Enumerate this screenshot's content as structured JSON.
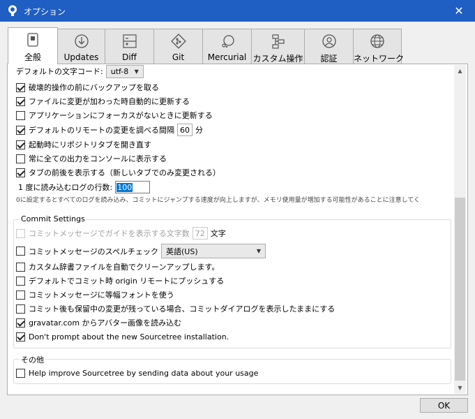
{
  "window": {
    "title": "オプション",
    "close_glyph": "✕"
  },
  "tabs": [
    {
      "label": "全般",
      "icon": "switch-icon",
      "active": true
    },
    {
      "label": "Updates",
      "icon": "download-circle-icon"
    },
    {
      "label": "Diff",
      "icon": "diff-icon"
    },
    {
      "label": "Git",
      "icon": "git-icon"
    },
    {
      "label": "Mercurial",
      "icon": "mercurial-icon"
    },
    {
      "label": "カスタム操作",
      "icon": "custom-actions-icon"
    },
    {
      "label": "認証",
      "icon": "user-icon"
    },
    {
      "label": "ネットワーク",
      "icon": "globe-icon"
    }
  ],
  "general": {
    "encoding_label": "デフォルトの文字コード:",
    "encoding_value": "utf-8",
    "options": [
      {
        "label": "破壊的操作の前にバックアップを取る",
        "checked": true
      },
      {
        "label": "ファイルに変更が加わった時自動的に更新する",
        "checked": true
      },
      {
        "label": "アプリケーションにフォーカスがないときに更新する",
        "checked": false
      },
      {
        "label": "デフォルトのリモートの変更を調べる間隔",
        "checked": true,
        "value": "60",
        "unit": "分"
      },
      {
        "label": "起動時にリポジトリタブを開き直す",
        "checked": true
      },
      {
        "label": "常に全ての出力をコンソールに表示する",
        "checked": false
      },
      {
        "label": "タブの前後を表示する（新しいタブでのみ変更される）",
        "checked": true
      }
    ],
    "log_count_label": "1 度に読み込むログの行数:",
    "log_count_value": "100",
    "log_note": "0に設定するとすべてのログを読み込み、コミットにジャンプする速度が向上しますが、メモリ使用量が増加する可能性があることに注意してく"
  },
  "commit_settings": {
    "title": "Commit Settings",
    "guide_label": "コミットメッセージでガイドを表示する文字数",
    "guide_value": "72",
    "guide_unit": "文字",
    "spellcheck_label": "コミットメッセージのスペルチェック",
    "spellcheck_language": "英語(US)",
    "options": [
      {
        "label": "カスタム辞書ファイルを自動でクリーンアップします。",
        "checked": false
      },
      {
        "label": "デフォルトでコミット時 origin リモートにプッシュする",
        "checked": false
      },
      {
        "label": "コミットメッセージに等幅フォントを使う",
        "checked": false
      },
      {
        "label": "コミット後も保留中の変更が残っている場合、コミットダイアログを表示したままにする",
        "checked": false
      },
      {
        "label": "gravatar.com からアバター画像を読み込む",
        "checked": true
      },
      {
        "label": "Don't prompt about the new Sourcetree installation.",
        "checked": true
      }
    ]
  },
  "other": {
    "title": "その他",
    "options": [
      {
        "label": "Help improve Sourcetree by sending data about your usage",
        "checked": false
      }
    ]
  },
  "footer": {
    "ok_label": "OK"
  },
  "colors": {
    "titlebar": "#1f5ec2",
    "selection": "#0078d7"
  }
}
